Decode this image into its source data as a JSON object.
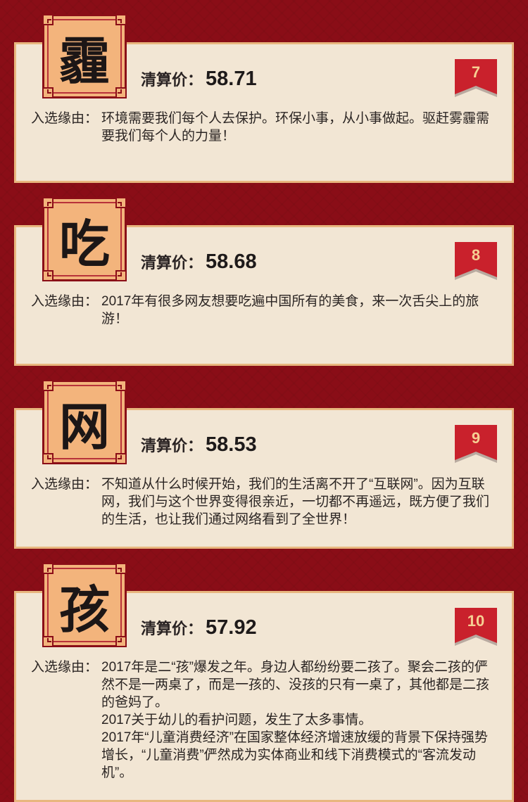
{
  "price_label": "清算价：",
  "reason_label": "入选缘由：",
  "entries": [
    {
      "rank": "7",
      "word": "霾",
      "price": "58.71",
      "reason": [
        "环境需要我们每个人去保护。环保小事，从小事做起。驱赶雾霾需要我们每个人的力量！"
      ]
    },
    {
      "rank": "8",
      "word": "吃",
      "price": "58.68",
      "reason": [
        "2017年有很多网友想要吃遍中国所有的美食，来一次舌尖上的旅游！"
      ]
    },
    {
      "rank": "9",
      "word": "网",
      "price": "58.53",
      "reason": [
        "不知道从什么时候开始，我们的生活离不开了“互联网”。因为互联网，我们与这个世界变得很亲近，一切都不再遥远，既方便了我们的生活，也让我们通过网络看到了全世界！"
      ]
    },
    {
      "rank": "10",
      "word": "孩",
      "price": "57.92",
      "reason": [
        "2017年是二“孩”爆发之年。身边人都纷纷要二孩了。聚会二孩的俨然不是一两桌了，而是一孩的、没孩的只有一桌了，其他都是二孩的爸妈了。",
        "2017关于幼儿的看护问题，发生了太多事情。",
        "2017年“儿童消费经济”在国家整体经济增速放缓的背景下保持强势增长，“儿童消费”俨然成为实体商业和线下消费模式的“客流发动机”。"
      ]
    }
  ]
}
